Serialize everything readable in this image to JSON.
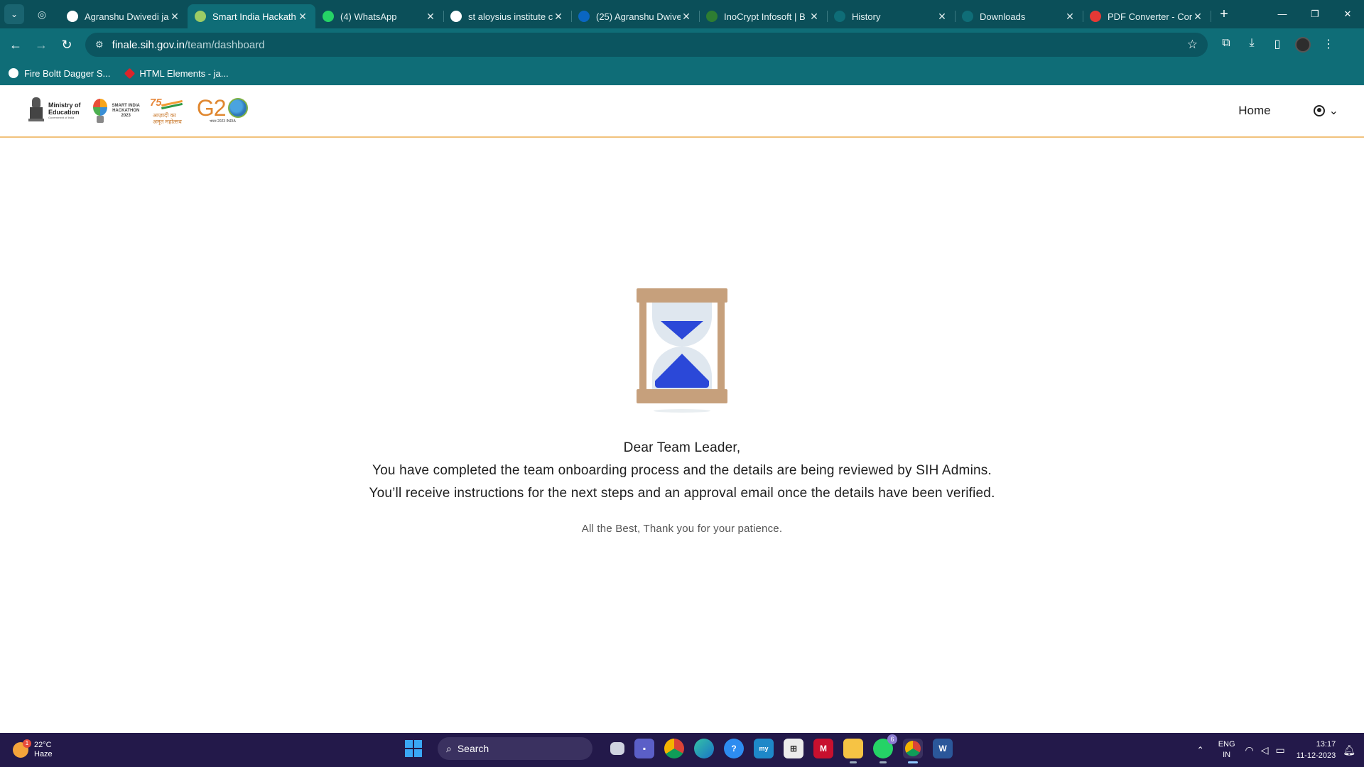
{
  "browser": {
    "tabs": [
      {
        "title": "Agranshu Dwivedi ja",
        "favicon": "google-icon",
        "color": "#ffffff",
        "active": false
      },
      {
        "title": "Smart India Hackath",
        "favicon": "sih-bulb-icon",
        "color": "#9ccc65",
        "active": true
      },
      {
        "title": "(4) WhatsApp",
        "favicon": "whatsapp-icon",
        "color": "#25d366",
        "active": false
      },
      {
        "title": "st aloysius institute c",
        "favicon": "google-icon",
        "color": "#ffffff",
        "active": false
      },
      {
        "title": "(25) Agranshu Dwive",
        "favicon": "linkedin-icon",
        "color": "#0a66c2",
        "active": false
      },
      {
        "title": "InoCrypt Infosoft | B",
        "favicon": "inocrypt-icon",
        "color": "#2e7d32",
        "active": false
      },
      {
        "title": "History",
        "favicon": "history-icon",
        "color": "#0f6d77",
        "active": false
      },
      {
        "title": "Downloads",
        "favicon": "download-icon",
        "color": "#0f6d77",
        "active": false
      },
      {
        "title": "PDF Converter - Cor",
        "favicon": "pdf-converter-icon",
        "color": "#e53935",
        "active": false
      }
    ],
    "url_host": "finale.sih.gov.in",
    "url_path": "/team/dashboard",
    "bookmarks": [
      {
        "label": "Fire Boltt Dagger S..."
      },
      {
        "label": "HTML Elements - ja..."
      }
    ]
  },
  "site": {
    "logos": {
      "moe_line1": "Ministry of",
      "moe_line2": "Education",
      "moe_sub": "Government of India",
      "sih_line1": "SMART INDIA",
      "sih_line2": "HACKATHON",
      "sih_year": "2023",
      "aam_number": "75",
      "aam_hindi": "आज़ादी का अमृत महोत्सव",
      "g20": "G2",
      "g20_sub": "भारत 2023 INDIA"
    },
    "nav_home": "Home"
  },
  "message": {
    "greeting": "Dear Team Leader,",
    "line1": "You have completed the team onboarding process and the details are being reviewed by SIH Admins.",
    "line2": "You’ll receive instructions for the next steps and an approval email once the details have been verified.",
    "closing": "All the Best, Thank you for your patience."
  },
  "taskbar": {
    "weather_temp": "22°C",
    "weather_desc": "Haze",
    "weather_badge": "1",
    "search_label": "Search",
    "whatsapp_badge": "6",
    "lang_top": "ENG",
    "lang_bottom": "IN",
    "time": "13:17",
    "date": "11-12-2023"
  },
  "colors": {
    "chrome_dark": "#0b4f59",
    "chrome": "#0f6d77",
    "header_border": "#f1c27d",
    "hourglass_frame": "#c6a07c",
    "sand": "#2b48d8",
    "taskbar": "#23194a"
  }
}
